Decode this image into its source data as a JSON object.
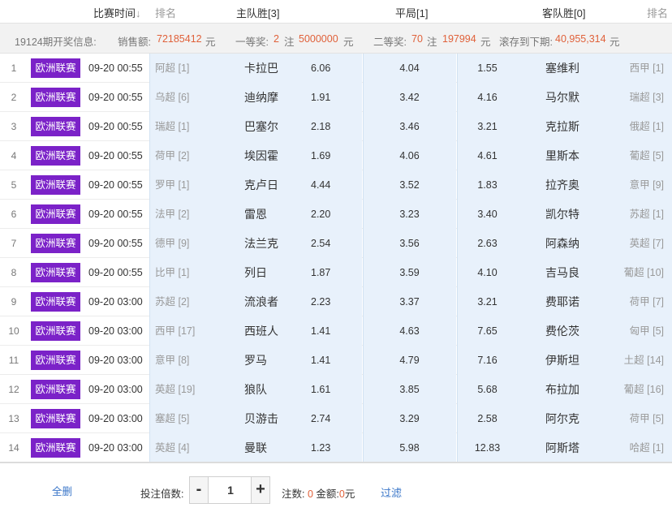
{
  "header": {
    "match_time": "比赛时间",
    "sort_arrow": "↓",
    "rank_left": "排名",
    "home_win": "主队胜[3]",
    "draw": "平局[1]",
    "away_win": "客队胜[0]",
    "rank_right": "排名"
  },
  "info": {
    "period": "19124期开奖信息:",
    "sales_label": "销售额:",
    "sales_value": "72185412",
    "sales_unit": "元",
    "first_label": "一等奖:",
    "first_count": "2",
    "first_mid": "注",
    "first_amount": "5000000",
    "first_unit": "元",
    "second_label": "二等奖:",
    "second_count": "70",
    "second_mid": "注",
    "second_amount": "197994",
    "second_unit": "元",
    "rollover_label": "滚存到下期:",
    "rollover_value": "40,955,314",
    "rollover_unit": "元"
  },
  "rows": [
    {
      "num": "1",
      "league": "欧洲联赛",
      "time": "09-20 00:55",
      "home_rank": "阿超 [1]",
      "home": "卡拉巴",
      "home_odds": "6.06",
      "draw_odds": "4.04",
      "away_odds": "1.55",
      "away": "塞维利",
      "away_rank": "西甲 [1]"
    },
    {
      "num": "2",
      "league": "欧洲联赛",
      "time": "09-20 00:55",
      "home_rank": "乌超 [6]",
      "home": "迪纳摩",
      "home_odds": "1.91",
      "draw_odds": "3.42",
      "away_odds": "4.16",
      "away": "马尔默",
      "away_rank": "瑞超 [3]"
    },
    {
      "num": "3",
      "league": "欧洲联赛",
      "time": "09-20 00:55",
      "home_rank": "瑞超 [1]",
      "home": "巴塞尔",
      "home_odds": "2.18",
      "draw_odds": "3.46",
      "away_odds": "3.21",
      "away": "克拉斯",
      "away_rank": "俄超 [1]"
    },
    {
      "num": "4",
      "league": "欧洲联赛",
      "time": "09-20 00:55",
      "home_rank": "荷甲 [2]",
      "home": "埃因霍",
      "home_odds": "1.69",
      "draw_odds": "4.06",
      "away_odds": "4.61",
      "away": "里斯本",
      "away_rank": "葡超 [5]"
    },
    {
      "num": "5",
      "league": "欧洲联赛",
      "time": "09-20 00:55",
      "home_rank": "罗甲 [1]",
      "home": "克卢日",
      "home_odds": "4.44",
      "draw_odds": "3.52",
      "away_odds": "1.83",
      "away": "拉齐奥",
      "away_rank": "意甲 [9]"
    },
    {
      "num": "6",
      "league": "欧洲联赛",
      "time": "09-20 00:55",
      "home_rank": "法甲 [2]",
      "home": "雷恩",
      "home_odds": "2.20",
      "draw_odds": "3.23",
      "away_odds": "3.40",
      "away": "凯尔特",
      "away_rank": "苏超 [1]"
    },
    {
      "num": "7",
      "league": "欧洲联赛",
      "time": "09-20 00:55",
      "home_rank": "德甲 [9]",
      "home": "法兰克",
      "home_odds": "2.54",
      "draw_odds": "3.56",
      "away_odds": "2.63",
      "away": "阿森纳",
      "away_rank": "英超 [7]"
    },
    {
      "num": "8",
      "league": "欧洲联赛",
      "time": "09-20 00:55",
      "home_rank": "比甲 [1]",
      "home": "列日",
      "home_odds": "1.87",
      "draw_odds": "3.59",
      "away_odds": "4.10",
      "away": "吉马良",
      "away_rank": "葡超 [10]"
    },
    {
      "num": "9",
      "league": "欧洲联赛",
      "time": "09-20 03:00",
      "home_rank": "苏超 [2]",
      "home": "流浪者",
      "home_odds": "2.23",
      "draw_odds": "3.37",
      "away_odds": "3.21",
      "away": "费耶诺",
      "away_rank": "荷甲 [7]"
    },
    {
      "num": "10",
      "league": "欧洲联赛",
      "time": "09-20 03:00",
      "home_rank": "西甲 [17]",
      "home": "西班人",
      "home_odds": "1.41",
      "draw_odds": "4.63",
      "away_odds": "7.65",
      "away": "费伦茨",
      "away_rank": "匈甲 [5]"
    },
    {
      "num": "11",
      "league": "欧洲联赛",
      "time": "09-20 03:00",
      "home_rank": "意甲 [8]",
      "home": "罗马",
      "home_odds": "1.41",
      "draw_odds": "4.79",
      "away_odds": "7.16",
      "away": "伊斯坦",
      "away_rank": "土超 [14]"
    },
    {
      "num": "12",
      "league": "欧洲联赛",
      "time": "09-20 03:00",
      "home_rank": "英超 [19]",
      "home": "狼队",
      "home_odds": "1.61",
      "draw_odds": "3.85",
      "away_odds": "5.68",
      "away": "布拉加",
      "away_rank": "葡超 [16]"
    },
    {
      "num": "13",
      "league": "欧洲联赛",
      "time": "09-20 03:00",
      "home_rank": "塞超 [5]",
      "home": "贝游击",
      "home_odds": "2.74",
      "draw_odds": "3.29",
      "away_odds": "2.58",
      "away": "阿尔克",
      "away_rank": "荷甲 [5]"
    },
    {
      "num": "14",
      "league": "欧洲联赛",
      "time": "09-20 03:00",
      "home_rank": "英超 [4]",
      "home": "曼联",
      "home_odds": "1.23",
      "draw_odds": "5.98",
      "away_odds": "12.83",
      "away": "阿斯塔",
      "away_rank": "哈超 [1]"
    }
  ],
  "footer": {
    "clear_all": "全删",
    "multiplier_label": "投注倍数:",
    "minus": "-",
    "multiplier_value": "1",
    "plus": "+",
    "bets_label": "注数:",
    "bets_value": "0",
    "amount_label": "金额:",
    "amount_value": "0",
    "amount_unit": "元",
    "filter": "过滤"
  },
  "colors": {
    "league_badge": "#7b22c8",
    "cell_highlight": "#e8f1fb",
    "accent_red": "#e0613a",
    "link_blue": "#3b77c9"
  }
}
